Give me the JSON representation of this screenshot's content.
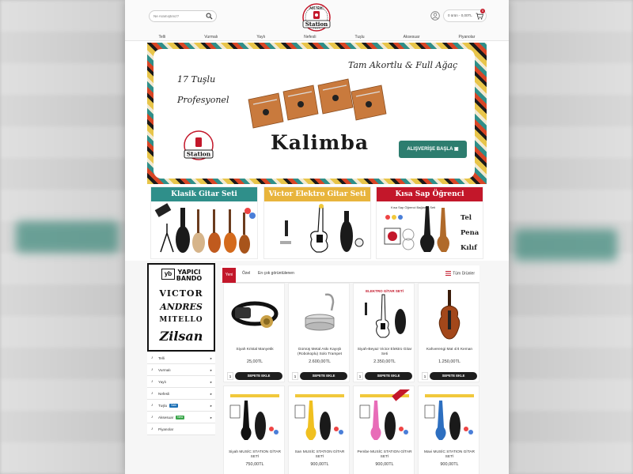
{
  "header": {
    "search_placeholder": "Ne Aramıştınız?",
    "cart_text": "0 ürün - 0,00TL",
    "cart_count": "0",
    "logo_top": "MUSIC",
    "logo_bottom": "Station",
    "nav": [
      "Telli",
      "Vurmalı",
      "Yaylı",
      "Nefesli",
      "Tuşlu",
      "Aksesuar",
      "Piyanolar"
    ]
  },
  "banner": {
    "line1": "17 Tuşlu",
    "line2": "Profesyonel",
    "line3": "Tam Akortlu & Full Ağaç",
    "title": "Kalimba",
    "button": "ALIŞVERİŞE BAŞLA"
  },
  "promos": [
    {
      "title": "Klasik Gitar Seti",
      "color": "#2f8f8a"
    },
    {
      "title": "Victor Elektro Gitar Seti",
      "color": "#e8b43c"
    },
    {
      "title": "Kısa Sap Öğrenci Bağlama Seti",
      "color": "#c3172a",
      "subtitle": "Kısa Sap Öğrenci Bağlama Seti",
      "words": [
        "Tel",
        "Pena",
        "Kılıf"
      ]
    }
  ],
  "brands": {
    "b1_mark": "yb",
    "b1_line1": "YAPICI",
    "b1_line2": "BANDO",
    "b2": "VICTOR",
    "b3": "ANDRES",
    "b4": "MITELLO",
    "b5": "Zilsan"
  },
  "categories": [
    {
      "label": "Telli",
      "chevron": true
    },
    {
      "label": "Vurmalı",
      "chevron": true
    },
    {
      "label": "Yaylı",
      "chevron": true
    },
    {
      "label": "Nefesli",
      "chevron": true
    },
    {
      "label": "Tuşlu",
      "chevron": true,
      "badge": "Sale",
      "badge_color": "#1a6fb5"
    },
    {
      "label": "Aksesuar",
      "chevron": true,
      "badge": "New",
      "badge_color": "#3aa64a"
    },
    {
      "label": "Piyanolar",
      "chevron": false
    }
  ],
  "tabs": {
    "active": "Yeni",
    "tab2": "Özel",
    "tab3": "En çok görüntülenen",
    "all": "Tüm Ürünler"
  },
  "products": [
    {
      "name": "Siyah Kristal Manyetik",
      "price": "25,00TL"
    },
    {
      "name": "Gümüş Metal Askı Kayışlı (Robokoplu) Solo Trampet",
      "price": "2.600,00TL"
    },
    {
      "name": "Siyah-Beyaz Victor Elektro Gitar Seti",
      "price": "2.350,00TL",
      "label": "ELEKTRO GİTAR SETİ"
    },
    {
      "name": "Kahverengi Mat 4/4 Keman",
      "price": "1.250,00TL"
    },
    {
      "name": "Siyah MUSİC STATION GİTAR SETİ",
      "price": "750,00TL"
    },
    {
      "name": "Sarı MUSİC STATION GİTAR SETİ",
      "price": "900,00TL"
    },
    {
      "name": "Pembe MUSİC STATION GİTAR SETİ",
      "price": "900,00TL"
    },
    {
      "name": "Mavi MUSİC STATION GİTAR SETİ",
      "price": "900,00TL"
    }
  ],
  "add_to_cart": "SEPETE EKLE",
  "qty": "1",
  "colors": {
    "accent": "#c3172a",
    "teal": "#2d7d6f",
    "dark": "#1e1e1e"
  }
}
